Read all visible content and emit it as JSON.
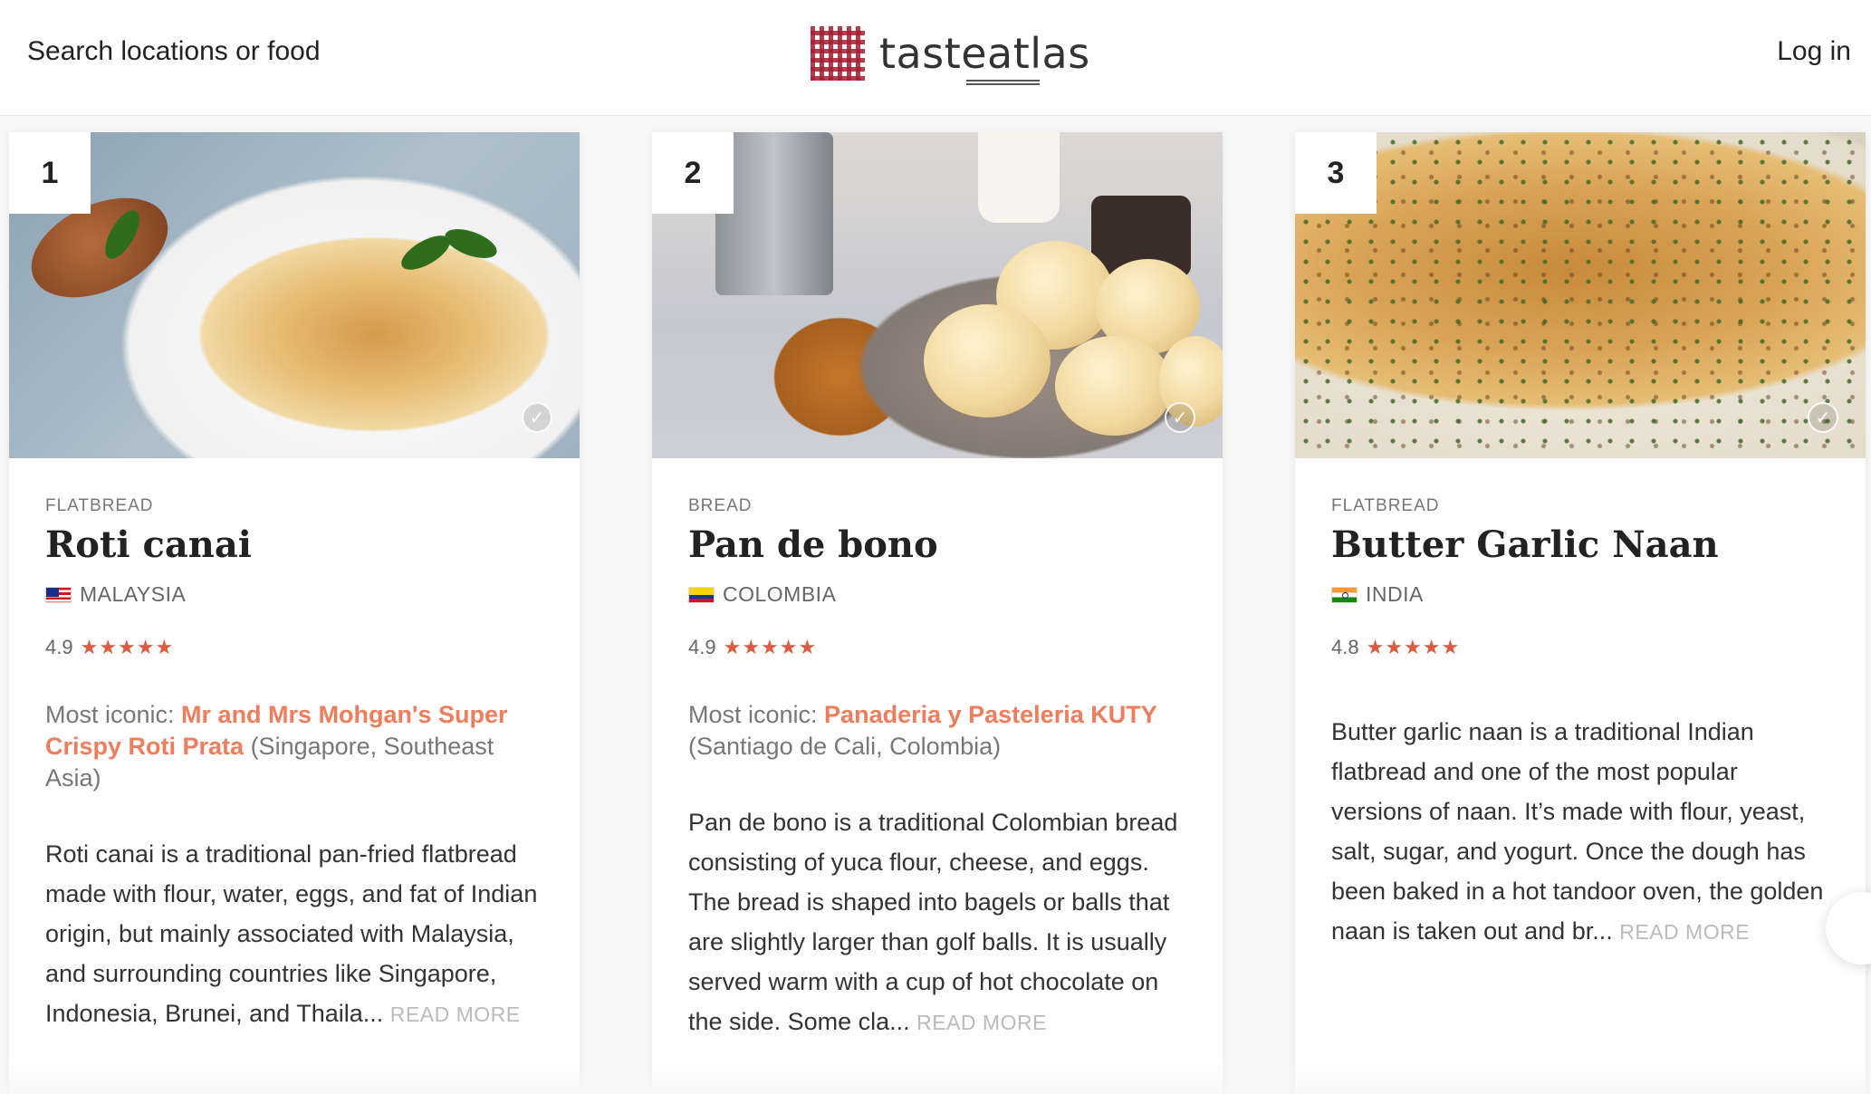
{
  "header": {
    "search_label": "Search locations or food",
    "logo_text": "tasteatlas",
    "login_label": "Log in"
  },
  "cards": [
    {
      "rank": "1",
      "category": "FLATBREAD",
      "name": "Roti canai",
      "country": "MALAYSIA",
      "rating": "4.9",
      "stars": "★★★★★",
      "iconic_prefix": "Most iconic: ",
      "iconic_name": "Mr and Mrs Mohgan's Super Crispy Roti Prata",
      "iconic_location": " (Singapore, Southeast Asia)",
      "description": "Roti canai is a traditional pan-fried flatbread made with flour, water, eggs, and fat of Indian origin, but mainly associated with Malaysia, and surrounding countries like Singapore, Indonesia, Brunei, and Thaila...",
      "read_more": "READ MORE"
    },
    {
      "rank": "2",
      "category": "BREAD",
      "name": "Pan de bono",
      "country": "COLOMBIA",
      "rating": "4.9",
      "stars": "★★★★★",
      "iconic_prefix": "Most iconic: ",
      "iconic_name": "Panaderia y Pasteleria KUTY",
      "iconic_location": " (Santiago de Cali, Colombia)",
      "description": "Pan de bono is a traditional Colombian bread consisting of yuca flour, cheese, and eggs. The bread is shaped into bagels or balls that are slightly larger than golf balls. It is usually served warm with a cup of hot chocolate on the side. Some cla...",
      "read_more": "READ MORE"
    },
    {
      "rank": "3",
      "category": "FLATBREAD",
      "name": "Butter Garlic Naan",
      "country": "INDIA",
      "rating": "4.8",
      "stars": "★★★★★",
      "description": "Butter garlic naan is a traditional Indian flatbread and one of the most popular versions of naan. It’s made with flour, yeast, salt, sugar, and yogurt. Once the dough has been baked in a hot tandoor oven, the golden naan is taken out and br...",
      "read_more": "READ MORE"
    }
  ],
  "colors": {
    "accent": "#ee7d5e",
    "star": "#e05a3f",
    "logo_red": "#a61c2f"
  },
  "icons": {
    "logo": "checkered-tablecloth-icon",
    "visited": "check-circle-icon",
    "star": "star-icon"
  }
}
